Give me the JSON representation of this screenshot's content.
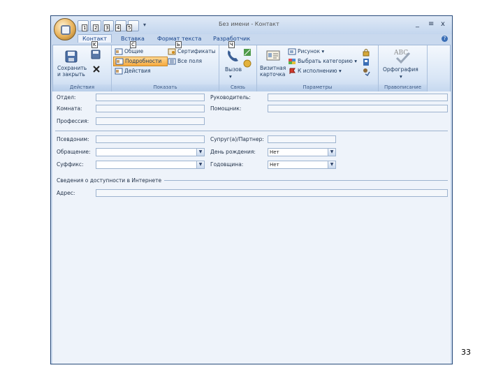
{
  "window": {
    "title": "Без имени - Контакт",
    "controls": [
      "_",
      "≡",
      "x"
    ],
    "qat_dropdown": "▾",
    "help_icon": "?"
  },
  "keytips": {
    "qat": [
      "1",
      "2",
      "3",
      "4",
      "5"
    ],
    "tabs": [
      "K",
      "C",
      "Ь",
      "Ч"
    ]
  },
  "tabs": [
    "Контакт",
    "Вставка",
    "Формат текста",
    "Разработчик"
  ],
  "ribbon": {
    "actions": {
      "label": "Действия",
      "save": "Сохранить\nи закрыть"
    },
    "show": {
      "label": "Показать",
      "items": [
        "Общие",
        "Подробности",
        "Действия",
        "Сертификаты",
        "Все поля"
      ]
    },
    "communicate": {
      "label": "Связь",
      "call": "Вызов"
    },
    "options": {
      "label": "Параметры",
      "business_card": "Визитная\nкарточка",
      "items": [
        "Рисунок ▾",
        "Выбрать категорию ▾",
        "К исполнению ▾"
      ]
    },
    "proofing": {
      "label": "Правописание",
      "spelling": "Орфография"
    }
  },
  "form": {
    "department": "Отдел:",
    "office": "Комната:",
    "profession": "Профессия:",
    "manager": "Руководитель:",
    "assistant": "Помощник:",
    "nickname": "Псевдоним:",
    "title": "Обращение:",
    "suffix": "Суффикс:",
    "spouse": "Супруг(а)/Партнер:",
    "birthday": "День рождения:",
    "anniversary": "Годовщина:",
    "birthday_value": "Нет",
    "anniversary_value": "Нет",
    "internet_section": "Сведения о доступности в Интернете",
    "address": "Адрес:"
  },
  "page_number": "33"
}
